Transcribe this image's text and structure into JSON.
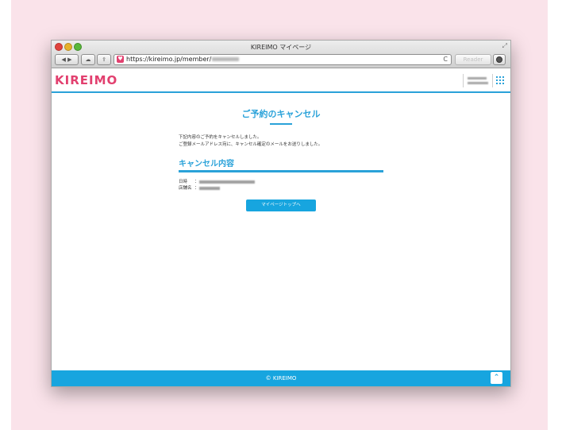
{
  "browser": {
    "window_title": "KIREIMO マイページ",
    "url_visible": "https://kireimo.jp/member/",
    "reader_label": "Reader",
    "nav_back": "◀",
    "nav_forward": "▶",
    "cloud_icon": "☁",
    "share_icon": "⇪",
    "reload_icon": "C",
    "fullscreen_icon": "⤢"
  },
  "site": {
    "logo": "KIREIMO"
  },
  "main": {
    "page_title": "ご予約のキャンセル",
    "message_line1": "下記内容のご予約をキャンセルしました。",
    "message_line2": "ご登録メールアドレス宛に、キャンセル確定のメールをお送りしました。",
    "section_title": "キャンセル内容",
    "details": [
      {
        "label": "日時",
        "colon": "："
      },
      {
        "label": "店舗名",
        "colon": "："
      }
    ],
    "button_label": "マイページトップへ"
  },
  "footer": {
    "copyright": "© KIREIMO",
    "back_to_top_icon": "⌃"
  },
  "colors": {
    "brand_pink": "#e2406f",
    "accent_blue": "#17a5df",
    "page_background": "#fae3ea"
  }
}
